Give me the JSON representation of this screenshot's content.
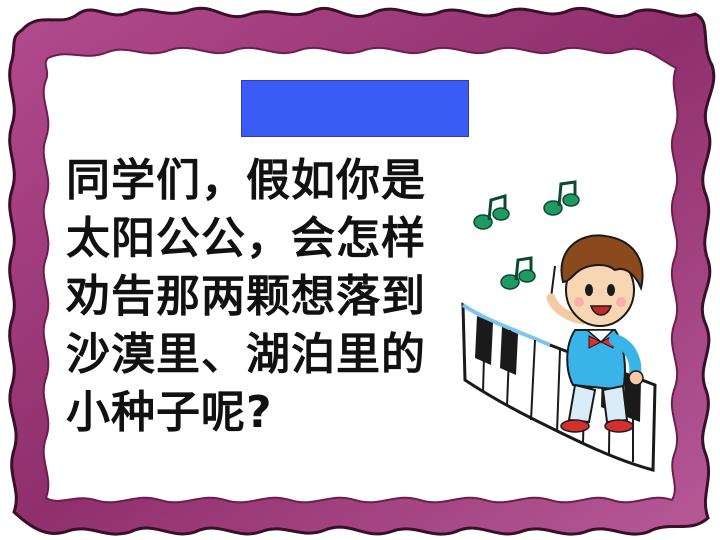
{
  "question": {
    "lines": [
      "同学们，假如你是",
      "太阳公公，会怎样",
      "劝告那两颗想落到",
      "沙漠里、湖泊里的",
      "小种子呢?"
    ]
  },
  "colors": {
    "frame": "#9c3a78",
    "frame_dark": "#6a1f4e",
    "blue_box": "#3b5bf5",
    "note": "#1f9a62",
    "shirt": "#38b4e8",
    "hair": "#8a4a1e"
  },
  "icons": [
    "torn-paper-frame",
    "music-note-icon",
    "conductor-boy",
    "piano-keys"
  ]
}
